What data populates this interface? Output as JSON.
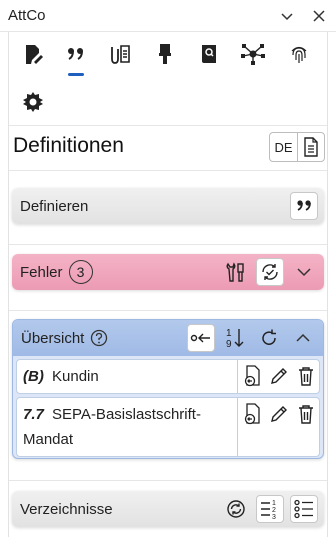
{
  "window": {
    "title": "AttCo"
  },
  "toolbar": {
    "row1": [
      "edit-document-icon",
      "quote-icon",
      "paperclip-icon",
      "brush-icon",
      "book-icon",
      "network-icon",
      "fingerprint-icon"
    ],
    "row2": [
      "gear-icon"
    ],
    "active": "quote-icon"
  },
  "header": {
    "title": "Definitionen",
    "language": "DE"
  },
  "sections": {
    "definieren": {
      "label": "Definieren"
    },
    "fehler": {
      "label": "Fehler",
      "count": "3"
    },
    "uebersicht": {
      "label": "Übersicht",
      "entries": [
        {
          "num": "(B)",
          "text": "Kundin"
        },
        {
          "num": "7.7",
          "text": "SEPA-Basislastschrift-Mandat"
        }
      ]
    },
    "verzeichnisse": {
      "label": "Verzeichnisse"
    }
  },
  "colors": {
    "accent": "#1f5fbf",
    "error": "#ec9bb4",
    "overview": "#9fbae6"
  }
}
